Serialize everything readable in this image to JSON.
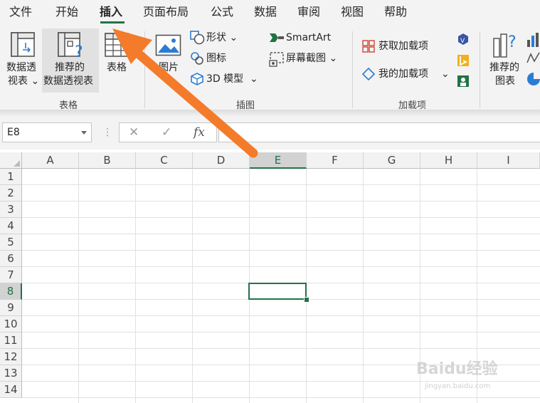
{
  "menu": {
    "tabs": [
      "文件",
      "开始",
      "插入",
      "页面布局",
      "公式",
      "数据",
      "审阅",
      "视图",
      "帮助"
    ],
    "active": "插入"
  },
  "ribbon": {
    "tables": {
      "pivot_line1": "数据透",
      "pivot_line2": "视表",
      "recommended_line1": "推荐的",
      "recommended_line2": "数据透视表",
      "table": "表格",
      "group_label": "表格"
    },
    "illustrations": {
      "picture": "图片",
      "shapes": "形状",
      "icons": "图标",
      "model3d": "3D 模型",
      "smartart": "SmartArt",
      "screenshot": "屏幕截图",
      "group_label": "插图"
    },
    "addins": {
      "get": "获取加载项",
      "my": "我的加载项",
      "group_label": "加载项"
    },
    "charts": {
      "recommended_line1": "推荐的",
      "recommended_line2": "图表"
    }
  },
  "formula_bar": {
    "name_box": "E8",
    "cancel": "✕",
    "enter": "✓",
    "fx": "fx",
    "value": ""
  },
  "sheet": {
    "columns": [
      "A",
      "B",
      "C",
      "D",
      "E",
      "F",
      "G",
      "H",
      "I"
    ],
    "rows": [
      "1",
      "2",
      "3",
      "4",
      "5",
      "6",
      "7",
      "8",
      "9",
      "10",
      "11",
      "12",
      "13",
      "14"
    ],
    "selected_column": "E",
    "selected_row": "8"
  },
  "watermark": {
    "brand": "Baidu经验",
    "url": "jingyan.baidu.com"
  },
  "colors": {
    "accent": "#217346",
    "annotation_arrow": "#f47b2a"
  }
}
